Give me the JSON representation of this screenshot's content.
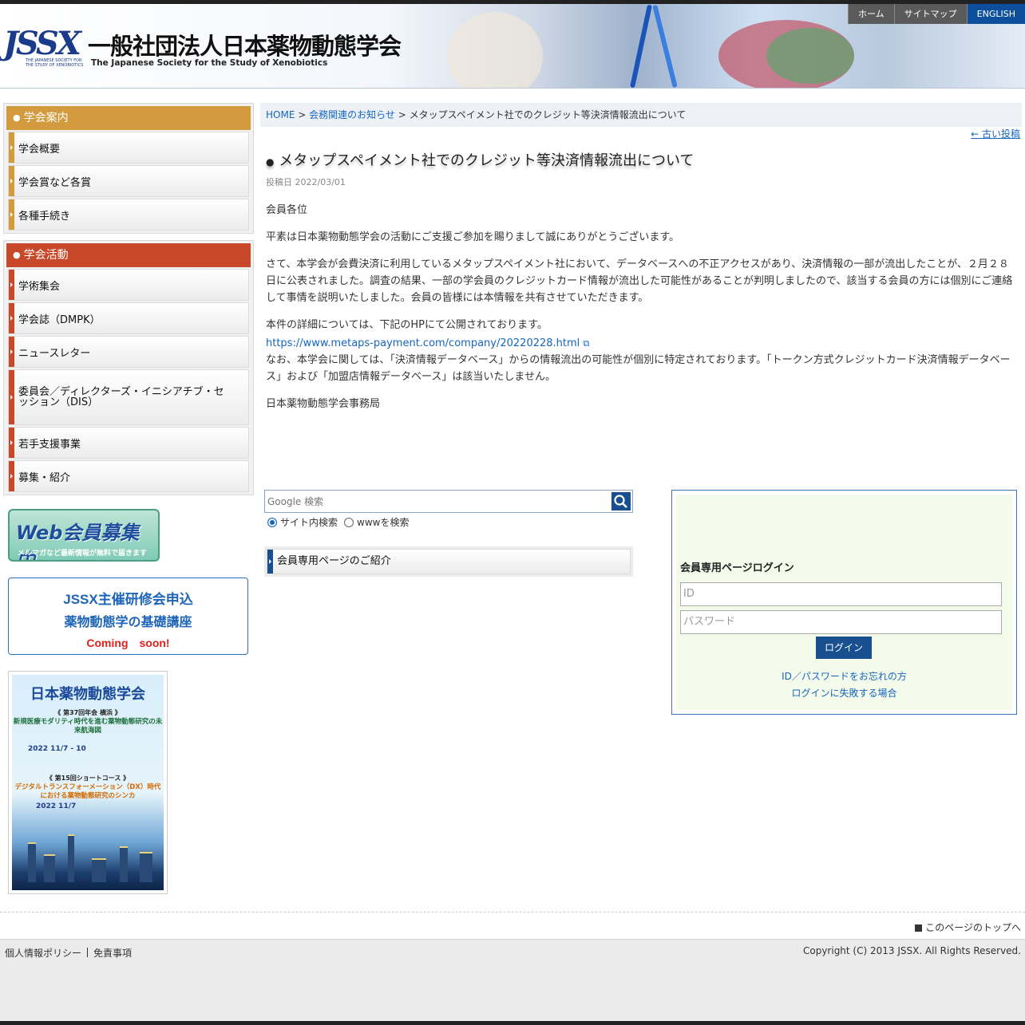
{
  "header": {
    "logo_mark": "JSSX",
    "logo_mark_sub": "THE JAPANESE SOCIETY FOR THE STUDY OF XENOBIOTICS",
    "logo_jp": "一般社団法人日本薬物動態学会",
    "logo_en": "The Japanese Society for the Study of Xenobiotics"
  },
  "topnav": [
    "ホーム",
    "サイトマップ",
    "ENGLISH"
  ],
  "sidebar": {
    "menu1": {
      "title": "学会案内",
      "color": "#d39a3e",
      "items": [
        "学会概要",
        "学会賞など各賞",
        "各種手続き"
      ]
    },
    "menu2": {
      "title": "学会活動",
      "color": "#c8482a",
      "items": [
        "学術集会",
        "学会誌（DMPK）",
        "ニュースレター",
        "委員会／ディレクターズ・イニシアチブ・セッション（DIS）",
        "若手支援事業",
        "募集・紹介"
      ]
    },
    "banner_web": {
      "title": "Web会員募集中",
      "sub": "メルマガなど最新情報が無料で届きます"
    },
    "seminar": {
      "line1": "JSSX主催研修会申込",
      "line2": "薬物動態学の基礎講座",
      "line3": "Coming　soon!"
    },
    "poster": {
      "title": "日本薬物動態学会",
      "meeting1": "《 第37回年会 横浜 》",
      "theme1": "新規医療モダリティ時代を進む薬物動態研究の未来航海図",
      "date1": "2022 11/7 - 10",
      "meeting2": "《 第15回ショートコース 》",
      "theme2": "デジタルトランスフォーメーション（DX）時代における薬物動態研究のシンカ",
      "date2": "2022 11/7"
    }
  },
  "breadcrumb": {
    "home": "HOME",
    "sep": ">",
    "category": "会務関連のお知らせ",
    "current": "メタップスペイメント社でのクレジット等決済情報流出について"
  },
  "older_link": "← 古い投稿",
  "post": {
    "title": "メタップスペイメント社でのクレジット等決済情報流出について",
    "date": "投稿日 2022/03/01",
    "p1": "会員各位",
    "p2": "平素は日本薬物動態学会の活動にご支援ご参加を賜りまして誠にありがとうございます。",
    "p3": "さて、本学会が会費決済に利用しているメタップスペイメント社において、データベースへの不正アクセスがあり、決済情報の一部が流出したことが、２月２８日に公表されました。調査の結果、一部の学会員のクレジットカード情報が流出した可能性があることが判明しましたので、該当する会員の方には個別にご連絡して事情を説明いたしました。会員の皆様には本情報を共有させていただきます。",
    "p4": "本件の詳細については、下記のHPにて公開されております。",
    "link": "https://www.metaps-payment.com/company/20220228.html",
    "p5": "なお、本学会に関しては、「決済情報データベース」からの情報流出の可能性が個別に特定されております。「トークン方式クレジットカード決済情報データベース」および「加盟店情報データベース」は該当いたしません。",
    "p6": "日本薬物動態学会事務局"
  },
  "search": {
    "placeholder": "Google 検索",
    "opt1": "サイト内検索",
    "opt2": "wwwを検索"
  },
  "member_intro": "会員専用ページのご紹介",
  "login": {
    "title": "会員専用ページログイン",
    "id_placeholder": "ID",
    "pw_placeholder": "パスワード",
    "button": "ログイン",
    "forgot": "ID／パスワードをお忘れの方",
    "fail": "ログインに失敗する場合"
  },
  "to_top": "このページのトップへ",
  "footer": {
    "privacy": "個人情報ポリシー",
    "disclaimer": "免責事項",
    "copyright": "Copyright (C) 2013 JSSX. All Rights Reserved."
  }
}
